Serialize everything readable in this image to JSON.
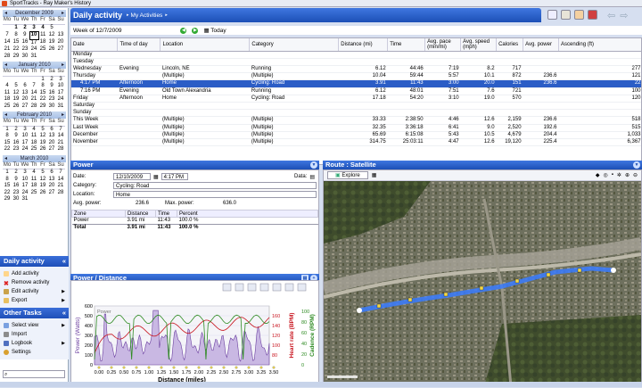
{
  "app": {
    "title": "SportTracks - Ray Maker's History"
  },
  "calendar": [
    {
      "month": "December 2009",
      "rows": [
        [
          "",
          "1",
          "2",
          "3",
          "4",
          "5",
          ""
        ],
        [
          "7",
          "8",
          "9",
          "10",
          "11",
          "12",
          "13"
        ],
        [
          "14",
          "15",
          "16",
          "17",
          "18",
          "19",
          "20"
        ],
        [
          "21",
          "22",
          "23",
          "24",
          "25",
          "26",
          "27"
        ],
        [
          "28",
          "29",
          "30",
          "31",
          "",
          "",
          ""
        ]
      ]
    },
    {
      "month": "January 2010",
      "rows": [
        [
          "",
          "",
          "",
          "",
          "1",
          "2",
          "3"
        ],
        [
          "4",
          "5",
          "6",
          "7",
          "8",
          "9",
          "10"
        ],
        [
          "11",
          "12",
          "13",
          "14",
          "15",
          "16",
          "17"
        ],
        [
          "18",
          "19",
          "20",
          "21",
          "22",
          "23",
          "24"
        ],
        [
          "25",
          "26",
          "27",
          "28",
          "29",
          "30",
          "31"
        ]
      ]
    },
    {
      "month": "February 2010",
      "rows": [
        [
          "1",
          "2",
          "3",
          "4",
          "5",
          "6",
          "7"
        ],
        [
          "8",
          "9",
          "10",
          "11",
          "12",
          "13",
          "14"
        ],
        [
          "15",
          "16",
          "17",
          "18",
          "19",
          "20",
          "21"
        ],
        [
          "22",
          "23",
          "24",
          "25",
          "26",
          "27",
          "28"
        ]
      ]
    },
    {
      "month": "March 2010",
      "rows": [
        [
          "1",
          "2",
          "3",
          "4",
          "5",
          "6",
          "7"
        ],
        [
          "8",
          "9",
          "10",
          "11",
          "12",
          "13",
          "14"
        ],
        [
          "15",
          "16",
          "17",
          "18",
          "19",
          "20",
          "21"
        ],
        [
          "22",
          "23",
          "24",
          "25",
          "26",
          "27",
          "28"
        ],
        [
          "29",
          "30",
          "31",
          "",
          "",
          "",
          ""
        ]
      ]
    }
  ],
  "weekdays": [
    "Mo",
    "Tu",
    "We",
    "Th",
    "Fr",
    "Sa",
    "Su"
  ],
  "activity_panel": {
    "title": "Daily activity",
    "items": [
      "Add activity",
      "Remove activity",
      "Edit activity",
      "Export"
    ]
  },
  "other_tasks": {
    "title": "Other Tasks",
    "items": [
      "Select view",
      "Import",
      "Logbook",
      "Settings"
    ]
  },
  "header": {
    "title": "Daily activity",
    "crumb": "My Activities"
  },
  "week": {
    "label": "Week of 12/7/2009",
    "today": "Today"
  },
  "grid": {
    "columns": [
      "Date",
      "Time of day",
      "Location",
      "Category",
      "Distance (mi)",
      "Time",
      "Avg. pace (min/mi)",
      "Avg. speed (mph)",
      "Calories",
      "Avg. power",
      "Ascending (ft)"
    ],
    "rows": [
      [
        "Monday",
        "",
        "",
        "",
        "",
        "",
        "",
        "",
        "",
        "",
        ""
      ],
      [
        "Tuesday",
        "",
        "",
        "",
        "",
        "",
        "",
        "",
        "",
        "",
        ""
      ],
      [
        "Wednesday",
        "Evening",
        "Lincoln, NE",
        "Running",
        "6.12",
        "44:46",
        "7:19",
        "8.2",
        "717",
        "",
        "277"
      ],
      [
        "Thursday",
        "",
        "(Multiple)",
        "(Multiple)",
        "10.04",
        "59:44",
        "5:57",
        "10.1",
        "872",
        "236.6",
        "121"
      ],
      [
        "4:17 PM",
        "Afternoon",
        "Home",
        "Cycling: Road",
        "3.91",
        "11:43",
        "3:00",
        "20.0",
        "151",
        "236.6",
        "22"
      ],
      [
        "7:16 PM",
        "Evening",
        "Old Town Alexandria",
        "Running",
        "6.12",
        "48:01",
        "7:51",
        "7.6",
        "721",
        "",
        "100"
      ],
      [
        "Friday",
        "Afternoon",
        "Home",
        "Cycling: Road",
        "17.18",
        "54:20",
        "3:10",
        "19.0",
        "570",
        "",
        "120"
      ],
      [
        "Saturday",
        "",
        "",
        "",
        "",
        "",
        "",
        "",
        "",
        "",
        ""
      ],
      [
        "Sunday",
        "",
        "",
        "",
        "",
        "",
        "",
        "",
        "",
        "",
        ""
      ],
      [
        "This Week",
        "",
        "(Multiple)",
        "(Multiple)",
        "33.33",
        "2:38:50",
        "4:46",
        "12.6",
        "2,159",
        "236.6",
        "518"
      ],
      [
        "Last Week",
        "",
        "(Multiple)",
        "(Multiple)",
        "32.35",
        "3:36:18",
        "6:41",
        "9.0",
        "2,520",
        "192.6",
        "515"
      ],
      [
        "December",
        "",
        "(Multiple)",
        "(Multiple)",
        "65.69",
        "6:15:08",
        "5:43",
        "10.5",
        "4,679",
        "204.4",
        "1,033"
      ],
      [
        "November",
        "",
        "(Multiple)",
        "(Multiple)",
        "314.75",
        "25:03:11",
        "4:47",
        "12.6",
        "19,120",
        "225.4",
        "6,367"
      ]
    ]
  },
  "power": {
    "title": "Power",
    "date": "12/10/2009",
    "time": "4:17 PM",
    "category": "Cycling: Road",
    "location": "Home",
    "avg_power_label": "Avg. power:",
    "avg_power": "236.6",
    "max_power_label": "Max. power:",
    "max_power": "636.0",
    "labels": {
      "date": "Date:",
      "category": "Category:",
      "location": "Location:",
      "data": "Data:"
    },
    "zone_cols": [
      "Zone",
      "Distance",
      "Time",
      "Percent"
    ],
    "zones": [
      [
        "Power",
        "3.91 mi",
        "11:43",
        "100.0 %"
      ],
      [
        "Total",
        "3.91 mi",
        "11:43",
        "100.0 %"
      ]
    ]
  },
  "pd": {
    "title": "Power / Distance",
    "xlabel": "Distance (miles)",
    "y1": "Power (Watts)",
    "y2": "Heart rate (BPM)",
    "y3": "Cadence (RPM)",
    "legend": "Power",
    "xticks": [
      "0.00",
      "0.25",
      "0.50",
      "0.75",
      "1.00",
      "1.25",
      "1.50",
      "1.75",
      "2.00",
      "2.25",
      "2.50",
      "2.75",
      "3.00",
      "3.25",
      "3.50"
    ],
    "yticks": [
      "0",
      "100",
      "200",
      "300",
      "400",
      "500",
      "600"
    ],
    "y2ticks": [
      "80",
      "100",
      "120",
      "140",
      "160"
    ],
    "y3ticks": [
      "0",
      "20",
      "40",
      "60",
      "80",
      "100"
    ]
  },
  "route": {
    "title": "Route : Satellite",
    "explore": "Explore"
  },
  "colors": {
    "accent": "#1c4fb6",
    "power": "#6b3fa0",
    "hr": "#c8141e",
    "cad": "#2e8b22"
  }
}
